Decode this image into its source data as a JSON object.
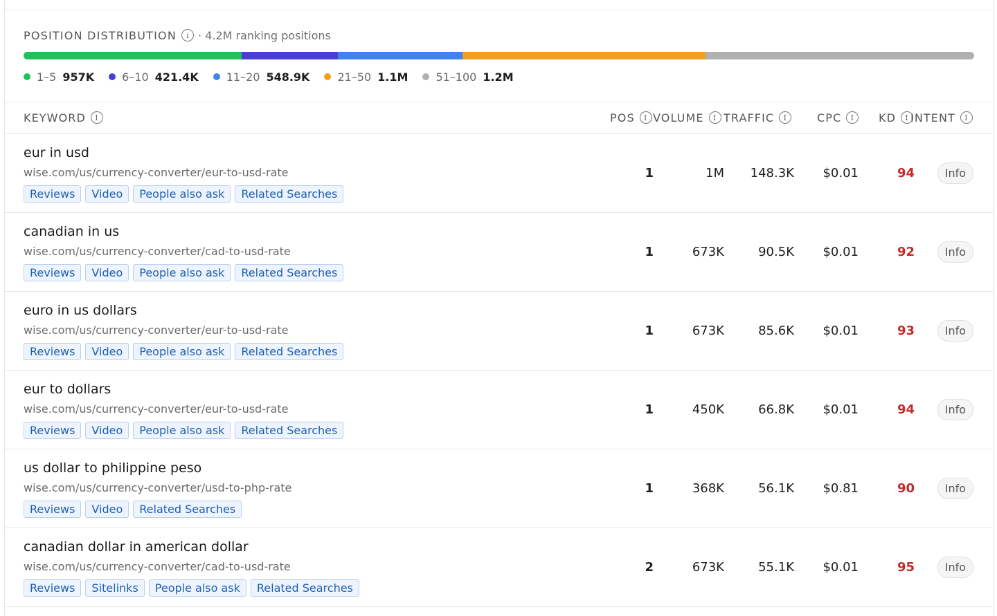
{
  "distribution": {
    "title": "POSITION DISTRIBUTION",
    "subtitle": "· 4.2M ranking positions",
    "segments": [
      {
        "range": "1–5",
        "value": "957K",
        "color": "#22c05a",
        "share": 0.2293
      },
      {
        "range": "6–10",
        "value": "421.4K",
        "color": "#4b3ed6",
        "share": 0.101
      },
      {
        "range": "11–20",
        "value": "548.9K",
        "color": "#3f84ee",
        "share": 0.1315
      },
      {
        "range": "21–50",
        "value": "1.1M",
        "color": "#f0a01e",
        "share": 0.2557
      },
      {
        "range": "51–100",
        "value": "1.2M",
        "color": "#b0b0b0",
        "share": 0.2825
      }
    ]
  },
  "table": {
    "headers": {
      "keyword": "KEYWORD",
      "pos": "POS",
      "volume": "VOLUME",
      "traffic": "TRAFFIC",
      "cpc": "CPC",
      "kd": "KD",
      "intent": "INTENT"
    },
    "rows": [
      {
        "keyword": "eur in usd",
        "url": "wise.com/us/currency-converter/eur-to-usd-rate",
        "tags": [
          "Reviews",
          "Video",
          "People also ask",
          "Related Searches"
        ],
        "pos": "1",
        "volume": "1M",
        "traffic": "148.3K",
        "cpc": "$0.01",
        "kd": "94",
        "intent": "Info"
      },
      {
        "keyword": "canadian in us",
        "url": "wise.com/us/currency-converter/cad-to-usd-rate",
        "tags": [
          "Reviews",
          "Video",
          "People also ask",
          "Related Searches"
        ],
        "pos": "1",
        "volume": "673K",
        "traffic": "90.5K",
        "cpc": "$0.01",
        "kd": "92",
        "intent": "Info"
      },
      {
        "keyword": "euro in us dollars",
        "url": "wise.com/us/currency-converter/eur-to-usd-rate",
        "tags": [
          "Reviews",
          "Video",
          "People also ask",
          "Related Searches"
        ],
        "pos": "1",
        "volume": "673K",
        "traffic": "85.6K",
        "cpc": "$0.01",
        "kd": "93",
        "intent": "Info"
      },
      {
        "keyword": "eur to dollars",
        "url": "wise.com/us/currency-converter/eur-to-usd-rate",
        "tags": [
          "Reviews",
          "Video",
          "People also ask",
          "Related Searches"
        ],
        "pos": "1",
        "volume": "450K",
        "traffic": "66.8K",
        "cpc": "$0.01",
        "kd": "94",
        "intent": "Info"
      },
      {
        "keyword": "us dollar to philippine peso",
        "url": "wise.com/us/currency-converter/usd-to-php-rate",
        "tags": [
          "Reviews",
          "Video",
          "Related Searches"
        ],
        "pos": "1",
        "volume": "368K",
        "traffic": "56.1K",
        "cpc": "$0.81",
        "kd": "90",
        "intent": "Info"
      },
      {
        "keyword": "canadian dollar in american dollar",
        "url": "wise.com/us/currency-converter/cad-to-usd-rate",
        "tags": [
          "Reviews",
          "Sitelinks",
          "People also ask",
          "Related Searches"
        ],
        "pos": "2",
        "volume": "673K",
        "traffic": "55.1K",
        "cpc": "$0.01",
        "kd": "95",
        "intent": "Info"
      }
    ]
  }
}
